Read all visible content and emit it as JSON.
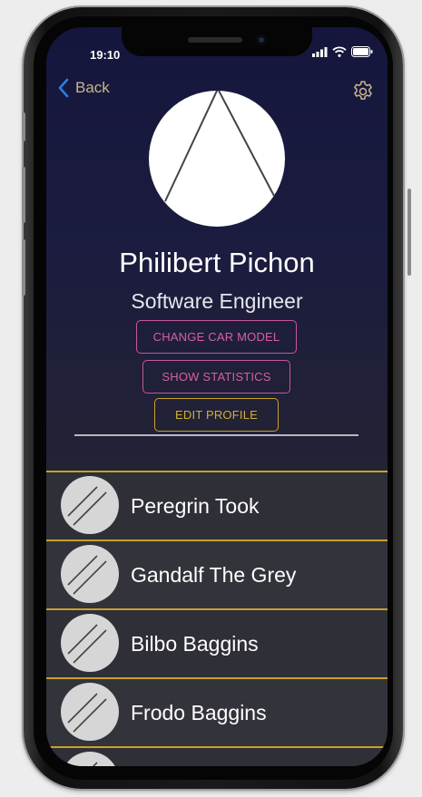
{
  "status_bar": {
    "time": "19:10"
  },
  "nav": {
    "back_label": "Back"
  },
  "profile": {
    "name": "Philibert Pichon",
    "role": "Software Engineer"
  },
  "actions": {
    "change_car_model": "CHANGE CAR MODEL",
    "show_statistics": "SHOW STATISTICS",
    "edit_profile": "EDIT PROFILE"
  },
  "contacts": [
    {
      "name": "Peregrin Took"
    },
    {
      "name": "Gandalf The Grey"
    },
    {
      "name": "Bilbo Baggins"
    },
    {
      "name": "Frodo Baggins"
    },
    {
      "name": ""
    }
  ],
  "colors": {
    "accent_gold": "#c9a227",
    "accent_pink": "#c4579d",
    "back_blue": "#2f7be6"
  }
}
